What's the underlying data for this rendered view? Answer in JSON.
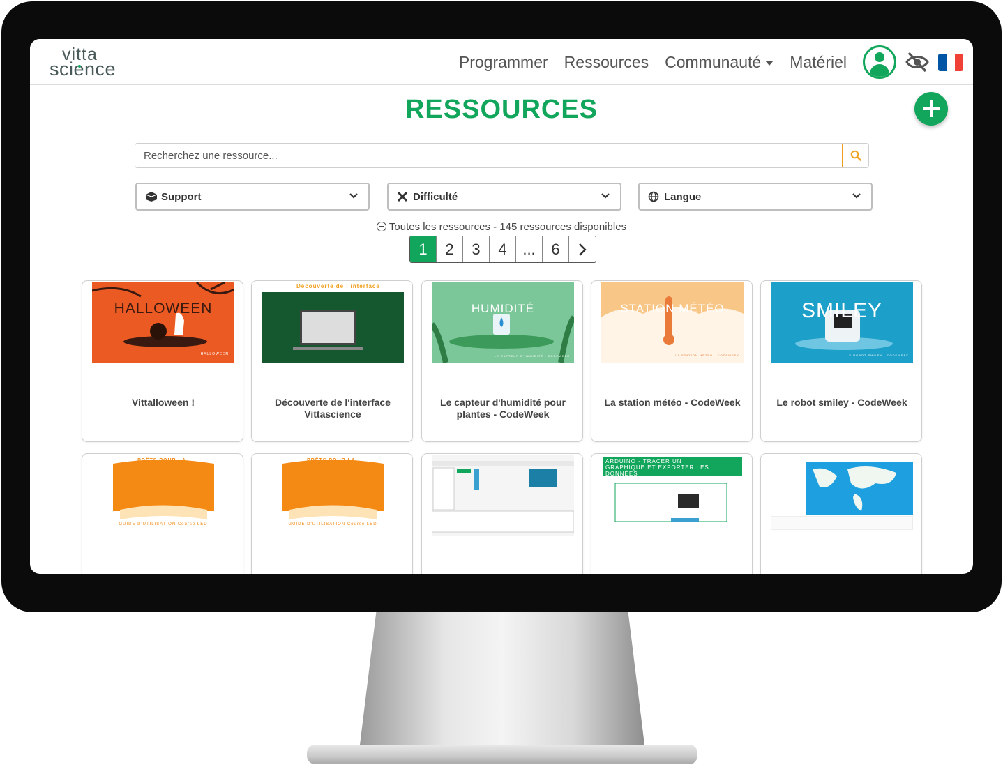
{
  "brand": {
    "logo_top": "vitta",
    "logo_bottom": "science"
  },
  "nav": {
    "links": [
      "Programmer",
      "Ressources",
      "Communauté",
      "Matériel"
    ],
    "flag_colors": [
      "#0055a4",
      "#ffffff",
      "#ef4135"
    ]
  },
  "page": {
    "title": "RESSOURCES",
    "search_placeholder": "Recherchez une ressource..."
  },
  "filters": [
    {
      "label": "Support",
      "icon": "box-icon"
    },
    {
      "label": "Difficulté",
      "icon": "tools-icon"
    },
    {
      "label": "Langue",
      "icon": "globe-icon"
    }
  ],
  "info_text": "Toutes les ressources - 145 ressources disponibles",
  "pagination": {
    "pages": [
      "1",
      "2",
      "3",
      "4",
      "...",
      "6"
    ],
    "current": "1"
  },
  "cards": [
    {
      "title": "Vittalloween !",
      "thumb_text": "HALLOWEEN",
      "thumb_sub": "HALLOWEEN"
    },
    {
      "title": "Découverte de l'interface Vittascience",
      "thumb_text": "Découverte de l'interface",
      "thumb_sub": ""
    },
    {
      "title": "Le capteur d'humidité pour plantes - CodeWeek",
      "thumb_text": "HUMIDITÉ",
      "thumb_sub": "LE CAPTEUR D'HUMIDITÉ - CODEWEEK"
    },
    {
      "title": "La station météo - CodeWeek",
      "thumb_text": "STATION MÉTÉO",
      "thumb_sub": "LA STATION MÉTÉO - CODEWEEK"
    },
    {
      "title": "Le robot smiley - CodeWeek",
      "thumb_text": "SMILEY",
      "thumb_sub": "LE ROBOT SMILEY - CODEWEEK"
    },
    {
      "title": "",
      "thumb_text": "PRÊTS POUR LA COURSE ?",
      "thumb_sub": "GUIDE D'UTILISATION Course LED"
    },
    {
      "title": "",
      "thumb_text": "PRÊTS POUR LA COURSE ?",
      "thumb_sub": "GUIDE D'UTILISATION Course LED"
    },
    {
      "title": "",
      "thumb_text": "",
      "thumb_sub": ""
    },
    {
      "title": "",
      "thumb_text": "ARDUINO - TRACER UN GRAPHIQUE ET EXPORTER LES DONNÉES",
      "thumb_sub": ""
    },
    {
      "title": "",
      "thumb_text": "",
      "thumb_sub": ""
    }
  ],
  "colors": {
    "accent": "#11a65b",
    "search_accent": "#f0a020"
  }
}
